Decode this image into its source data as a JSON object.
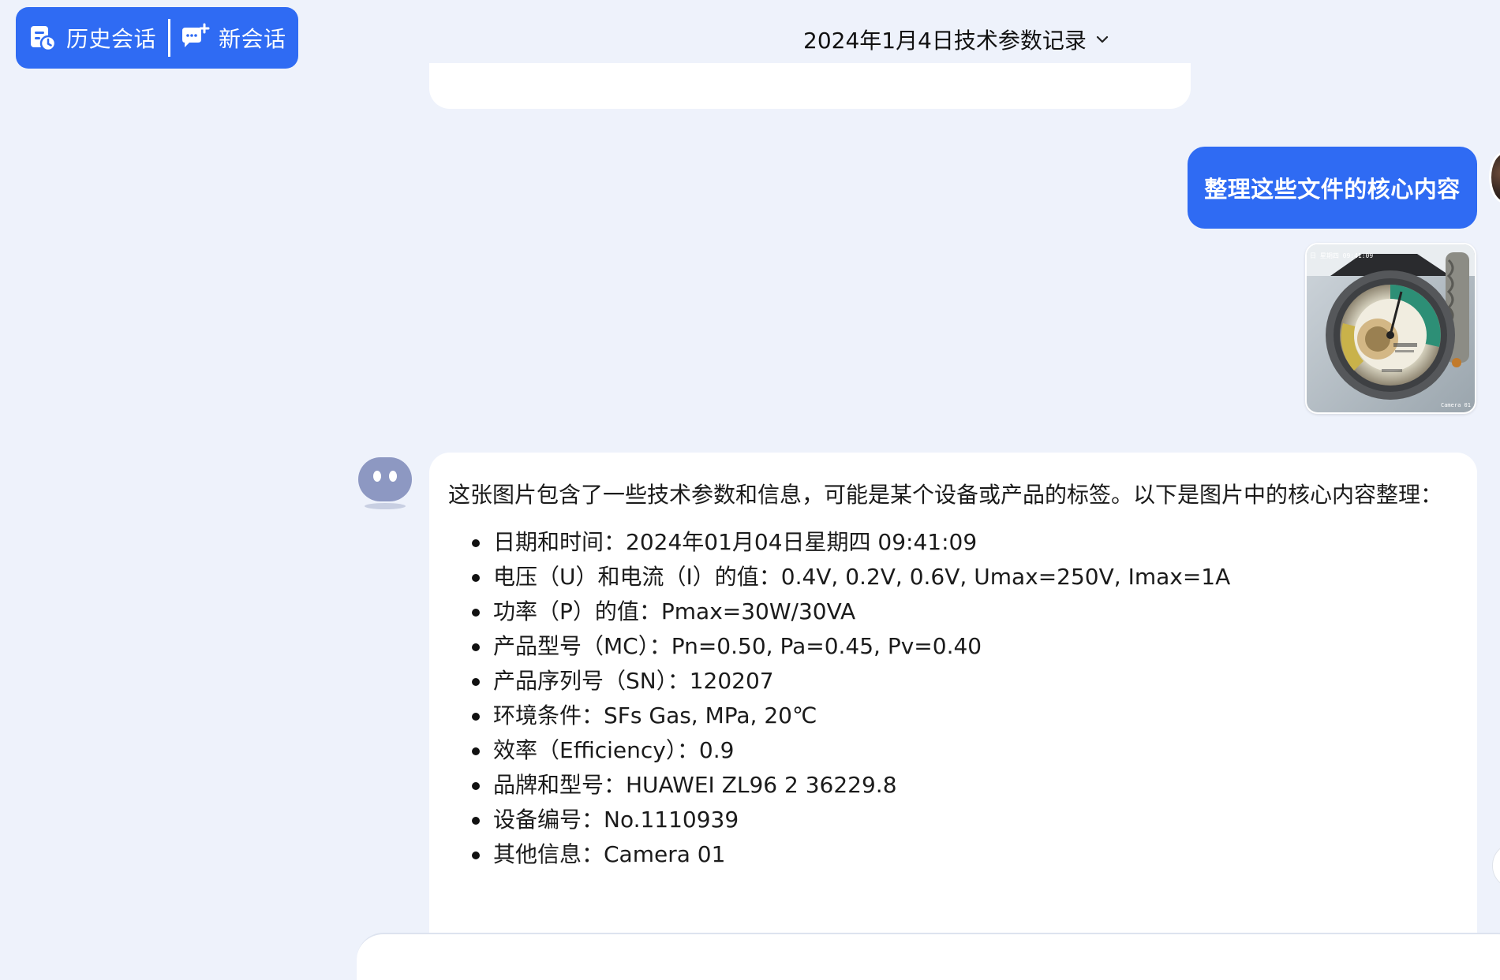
{
  "header": {
    "history_label": "历史会话",
    "new_chat_label": "新会话",
    "conversation_title": "2024年1月4日技术参数记录",
    "icons": {
      "history": "history-clock-icon",
      "new_chat": "chat-plus-icon",
      "title_dropdown": "chevron-down-icon"
    }
  },
  "user_message": {
    "text": "整理这些文件的核心内容",
    "image_overlay": {
      "timestamp": "日 星期四 09:41:09",
      "camera": "Camera 01"
    }
  },
  "bot_message": {
    "intro": "这张图片包含了一些技术参数和信息，可能是某个设备或产品的标签。以下是图片中的核心内容整理：",
    "items": [
      "日期和时间：2024年01月04日星期四 09:41:09",
      "电压（U）和电流（I）的值：0.4V, 0.2V, 0.6V, Umax=250V, Imax=1A",
      "功率（P）的值：Pmax=30W/30VA",
      "产品型号（MC）：Pn=0.50, Pa=0.45, Pv=0.40",
      "产品序列号（SN）：120207",
      "环境条件：SFs Gas, MPa, 20℃",
      "效率（Efficiency）：0.9",
      "品牌和型号：HUAWEI ZL96 2 36229.8",
      "设备编号：No.1110939",
      "其他信息：Camera 01"
    ]
  },
  "colors": {
    "brand_blue": "#2f6bf3",
    "page_background": "#eef2fb",
    "card_background": "#ffffff",
    "bot_avatar": "#8d98c2"
  }
}
